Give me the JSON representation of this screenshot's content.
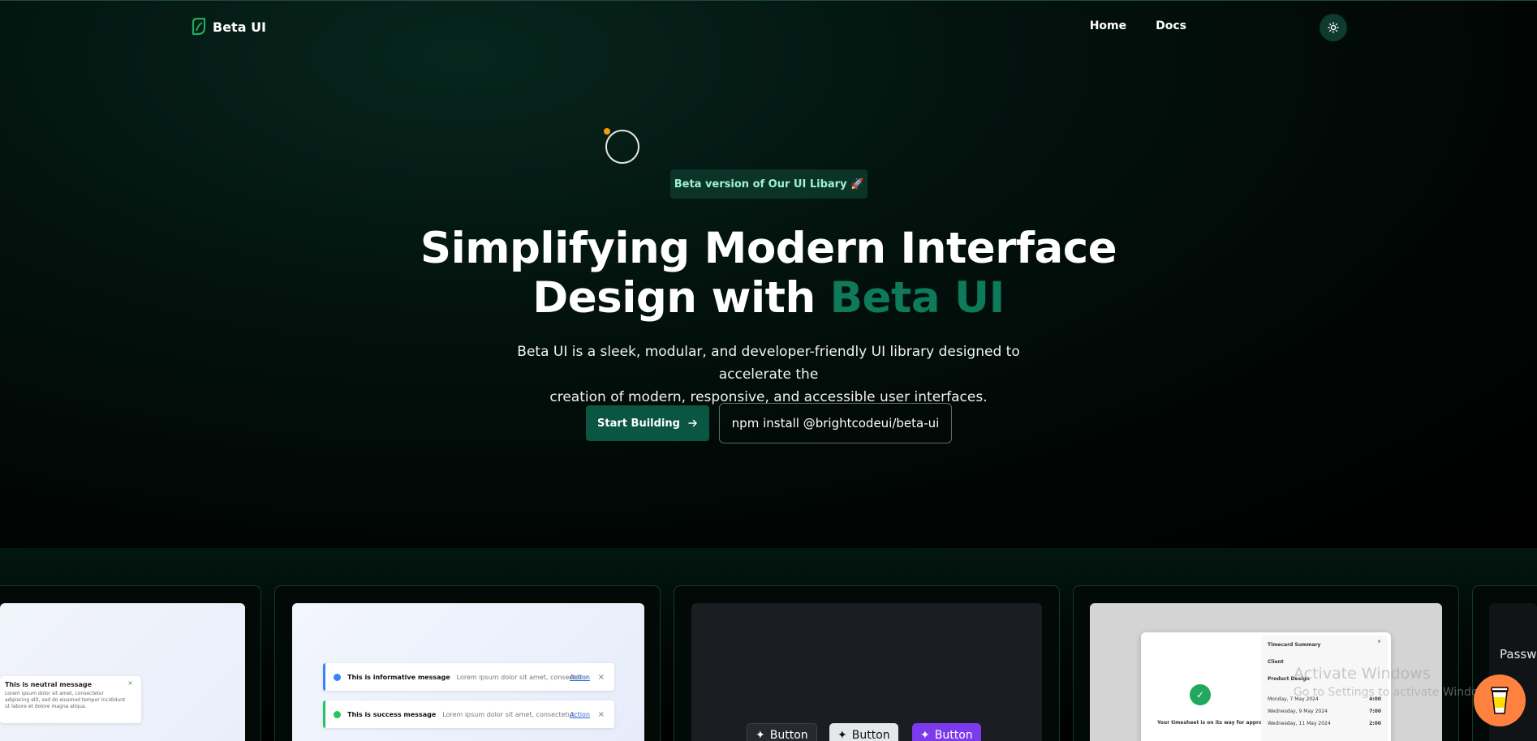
{
  "brand": {
    "name": "Beta UI",
    "logo_icon": "leaf-logo-icon",
    "color": "#22a75e"
  },
  "nav": {
    "links": [
      "Home",
      "Docs"
    ],
    "theme_icon": "sun-icon"
  },
  "hero": {
    "badge": "Beta version of Our UI Libary 🚀",
    "headline_line1": "Simplifying Modern Interface",
    "headline_line2_prefix": "Design with ",
    "headline_accent": "Beta UI",
    "subtitle_line1": "Beta UI is a sleek, modular, and developer-friendly UI library designed to accelerate the",
    "subtitle_line2": "creation of modern, responsive, and accessible user interfaces.",
    "cta_primary": "Start Building",
    "cta_secondary": "npm install @brightcodeui/beta-ui",
    "accent_color": "#0f7a5a"
  },
  "showcase": {
    "toast": {
      "title": "This is neutral message",
      "body": "Lorem ipsum dolor sit amet, consectetur adipiscing elit, sed do eiusmod tempor incididunt ut labore et dolore magna aliqua."
    },
    "alerts": [
      {
        "title": "This is informative message",
        "body": "Lorem ipsum dolor sit amet, consectetur.",
        "action": "Action",
        "color": "#3b82f6"
      },
      {
        "title": "This is success message",
        "body": "Lorem ipsum dolor sit amet, consectetur.",
        "action": "Action",
        "color": "#22c55e"
      }
    ],
    "buttons": [
      "Button",
      "Button",
      "Button"
    ],
    "timesheet": {
      "title": "Timecard Summary",
      "fields": [
        "Client",
        "Product Design"
      ],
      "message": "Your timesheet is on its way for approval!",
      "rows": [
        {
          "date": "Monday, 7 May 2024",
          "hours": "4:00"
        },
        {
          "date": "Wednesday, 9 May 2024",
          "hours": "7:00"
        },
        {
          "date": "Wednesday, 11 May 2024",
          "hours": "2:00"
        }
      ]
    },
    "password_label": "Passw"
  },
  "watermark": {
    "line1": "Activate Windows",
    "line2": "Go to Settings to activate Windows."
  }
}
